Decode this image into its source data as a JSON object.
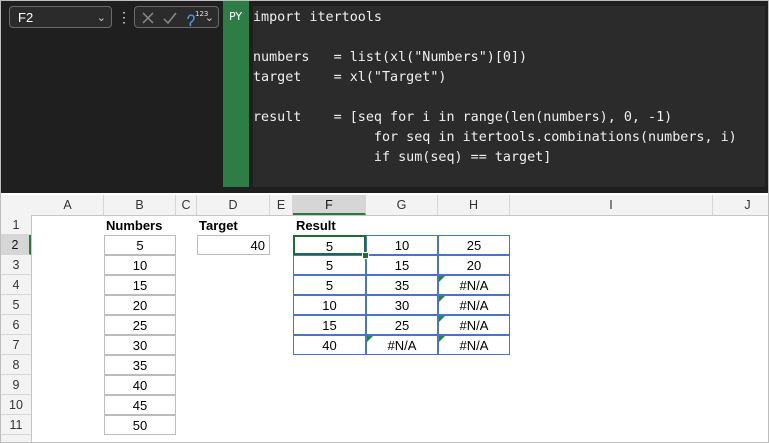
{
  "formula_bar": {
    "name_box": "F2",
    "fx_superscript": "123",
    "python_badge": "PY",
    "code": "import itertools\n\nnumbers   = list(xl(\"Numbers\")[0])\ntarget    = xl(\"Target\")\n\nresult    = [seq for i in range(len(numbers), 0, -1)\n               for seq in itertools.combinations(numbers, i)\n               if sum(seq) == target]"
  },
  "grid": {
    "columns": [
      "A",
      "B",
      "C",
      "D",
      "E",
      "F",
      "G",
      "H",
      "I",
      "J"
    ],
    "rows": [
      "1",
      "2",
      "3",
      "4",
      "5",
      "6",
      "7",
      "8",
      "9",
      "10",
      "11"
    ],
    "selected_column": "F",
    "selected_row": "2"
  },
  "numbers": {
    "header": "Numbers",
    "values": [
      "5",
      "10",
      "15",
      "20",
      "25",
      "30",
      "35",
      "40",
      "45",
      "50"
    ]
  },
  "target": {
    "header": "Target",
    "value": "40"
  },
  "result": {
    "header": "Result",
    "rows": [
      [
        "5",
        "10",
        "25"
      ],
      [
        "5",
        "15",
        "20"
      ],
      [
        "5",
        "35",
        "#N/A"
      ],
      [
        "10",
        "30",
        "#N/A"
      ],
      [
        "15",
        "25",
        "#N/A"
      ],
      [
        "40",
        "#N/A",
        "#N/A"
      ]
    ]
  },
  "colors": {
    "python_accent": "#2e7d46",
    "selection": "#1e6e33",
    "spill_border": "#4a74c9",
    "error_indicator": "#1e8a3c"
  },
  "icons": [
    "chevron-down-icon",
    "more-vertical-icon",
    "cancel-x-icon",
    "confirm-check-icon",
    "insert-function-icon"
  ]
}
